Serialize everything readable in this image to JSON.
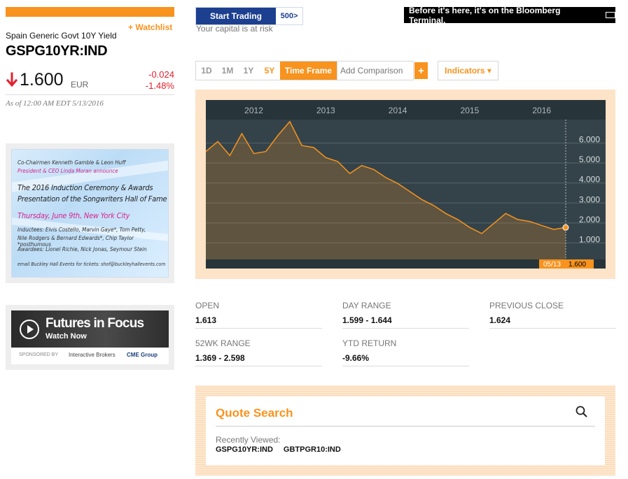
{
  "left": {
    "watchlist_label": "+ Watchlist",
    "security_name": "Spain Generic Govt 10Y Yield",
    "ticker": "GSPG10YR:IND",
    "price": "1.600",
    "currency": "EUR",
    "change_abs": "-0.024",
    "change_pct": "-1.48%",
    "as_of": "As of 12:00 AM EDT 5/13/2016",
    "direction_color": "#e5202e"
  },
  "ad1": {
    "line1": "Co-Chairmen Kenneth Gamble & Leon Huff",
    "line2": "President & CEO Linda Moran announce",
    "line3": "The 2016 Induction Ceremony & Awards",
    "line4": "Presentation of the Songwriters Hall of Fame",
    "line5": "Thursday, June 9th, New York City",
    "line6": "Inductees: Elvis Costello, Marvin Gaye*, Tom Petty,",
    "line7": "Nile Rodgers & Bernard Edwards*, Chip Taylor *posthumous",
    "line8": "Awardees: Lionel Richie, Nick Jonas, Seymour Stein",
    "line9": "email Buckley Hall Events for tickets: shof@buckleyhallevents.com"
  },
  "ad2": {
    "title": "Futures in Focus",
    "subtitle": "Watch Now",
    "sponsored_by": "SPONSORED BY",
    "sponsor1": "Interactive Brokers",
    "sponsor2": "CME Group"
  },
  "top": {
    "start_trading": "Start Trading",
    "broker_logo": "500>",
    "risk_note": "Your capital is at risk",
    "bloomberg_ad": "Before it's here, it's on the Bloomberg Terminal."
  },
  "toolbar": {
    "tabs": [
      "1D",
      "1M",
      "1Y",
      "5Y"
    ],
    "time_frame": "Time Frame",
    "add_comparison": "Add Comparison",
    "plus": "+",
    "indicators": "Indicators ▾"
  },
  "colors": {
    "accent": "#f7931e",
    "chart_bg": "#2d3a40",
    "chart_line": "#f7931e",
    "negative": "#e5202e",
    "start_trading_bg": "#1d3f8f"
  },
  "chart_data": {
    "type": "area",
    "x_ticks": [
      "2012",
      "2013",
      "2014",
      "2015",
      "2016"
    ],
    "y_ticks": [
      "6.000",
      "5.000",
      "4.000",
      "3.000",
      "2.000",
      "1.000"
    ],
    "ylim": [
      0,
      7
    ],
    "current_label_date": "05/13",
    "current_label_value": "1.600",
    "x": [
      "2011-05",
      "2011-07",
      "2011-09",
      "2011-11",
      "2012-01",
      "2012-03",
      "2012-05",
      "2012-07",
      "2012-09",
      "2012-11",
      "2013-01",
      "2013-03",
      "2013-05",
      "2013-07",
      "2013-09",
      "2013-11",
      "2014-01",
      "2014-03",
      "2014-05",
      "2014-07",
      "2014-09",
      "2014-11",
      "2015-01",
      "2015-03",
      "2015-05",
      "2015-07",
      "2015-09",
      "2015-11",
      "2016-01",
      "2016-03",
      "2016-05"
    ],
    "values": [
      5.4,
      5.9,
      5.2,
      6.3,
      5.3,
      5.4,
      6.2,
      6.9,
      5.7,
      5.6,
      5.1,
      4.9,
      4.3,
      4.7,
      4.5,
      4.1,
      3.8,
      3.4,
      3.0,
      2.7,
      2.3,
      2.0,
      1.6,
      1.3,
      1.8,
      2.3,
      2.0,
      1.9,
      1.7,
      1.5,
      1.6
    ]
  },
  "stats": [
    {
      "label": "OPEN",
      "value": "1.613"
    },
    {
      "label": "DAY RANGE",
      "value": "1.599 - 1.644"
    },
    {
      "label": "PREVIOUS CLOSE",
      "value": "1.624"
    },
    {
      "label": "52WK RANGE",
      "value": "1.369 - 2.598"
    },
    {
      "label": "YTD RETURN",
      "value": "-9.66%"
    }
  ],
  "quote_search": {
    "title": "Quote Search",
    "recently_viewed": "Recently Viewed:",
    "items": [
      "GSPG10YR:IND",
      "GBTPGR10:IND"
    ]
  }
}
